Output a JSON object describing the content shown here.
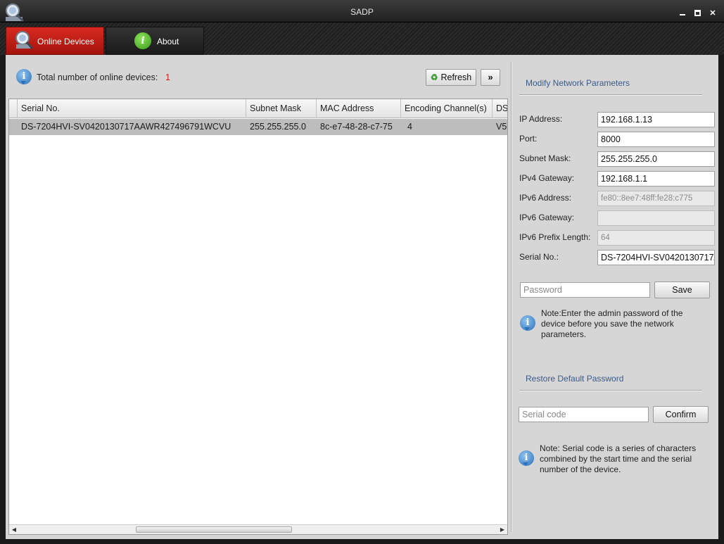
{
  "window": {
    "title": "SADP"
  },
  "tabs": [
    {
      "label": "Online Devices",
      "active": true
    },
    {
      "label": "About",
      "active": false
    }
  ],
  "summary": {
    "label": "Total number of online devices:",
    "count": "1"
  },
  "toolbar": {
    "refresh_label": "Refresh",
    "expand_label": "»"
  },
  "table": {
    "columns": [
      "Serial No.",
      "Subnet Mask",
      "MAC Address",
      "Encoding Channel(s)",
      "DS"
    ],
    "rows": [
      {
        "serial": "DS-7204HVI-SV0420130717AAWR427496791WCVU",
        "subnet": "255.255.255.0",
        "mac": "8c-e7-48-28-c7-75",
        "channels": "4",
        "ds": "V5."
      }
    ]
  },
  "modify": {
    "title": "Modify Network Parameters",
    "fields": [
      {
        "label": "IP Address:",
        "value": "192.168.1.13",
        "disabled": false
      },
      {
        "label": "Port:",
        "value": "8000",
        "disabled": false
      },
      {
        "label": "Subnet Mask:",
        "value": "255.255.255.0",
        "disabled": false
      },
      {
        "label": "IPv4 Gateway:",
        "value": "192.168.1.1",
        "disabled": false
      },
      {
        "label": "IPv6 Address:",
        "value": "fe80::8ee7:48ff:fe28:c775",
        "disabled": true
      },
      {
        "label": "IPv6 Gateway:",
        "value": "",
        "disabled": true
      },
      {
        "label": "IPv6 Prefix Length:",
        "value": "64",
        "disabled": true
      },
      {
        "label": "Serial No.:",
        "value": "DS-7204HVI-SV0420130717/",
        "disabled": false
      }
    ],
    "password_placeholder": "Password",
    "save_label": "Save",
    "note": "Note:Enter the admin password of the device before you save the network parameters."
  },
  "restore": {
    "title": "Restore Default Password",
    "serial_placeholder": "Serial code",
    "confirm_label": "Confirm",
    "note": "Note: Serial code is a series of characters combined by the start time and the serial number of the device."
  },
  "colors": {
    "accent_red": "#c81e15",
    "count_red": "#d21d1d",
    "section_blue": "#3a5b8a"
  }
}
